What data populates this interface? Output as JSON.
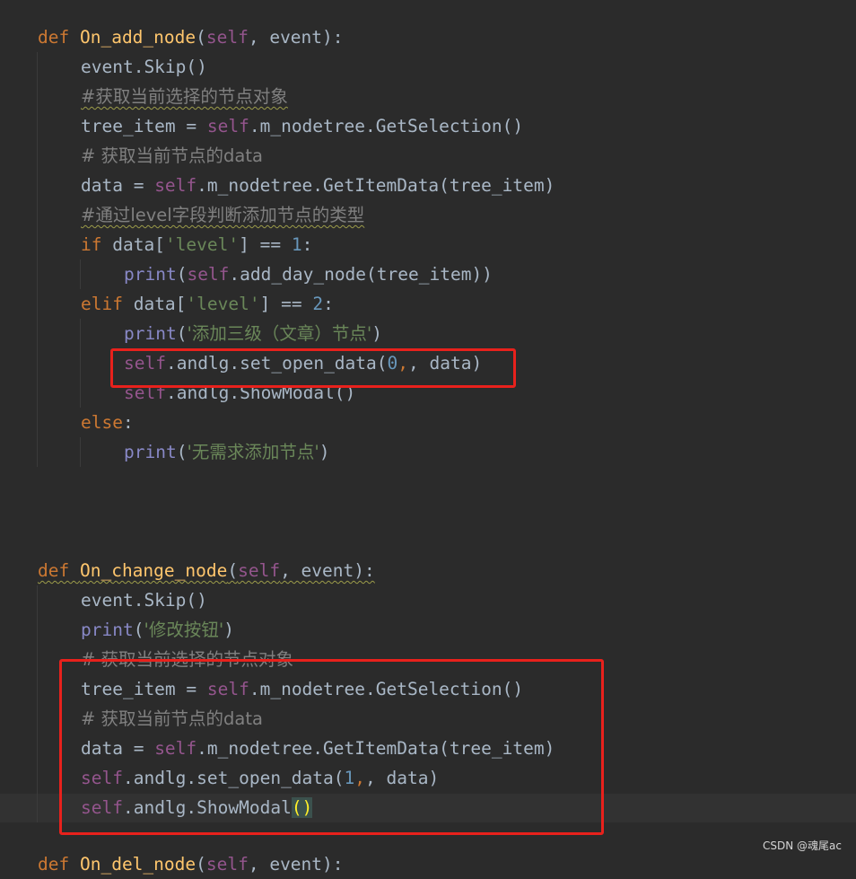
{
  "editor": {
    "current_line_note": "caret after ShowModal()",
    "func1": {
      "def_kw": "def",
      "name": "On_add_node",
      "open": "(",
      "self": "self",
      "params_rest": ", event):",
      "l1": "event.Skip()",
      "c1": "#获取当前选择的节点对象",
      "l2_a": "tree_item = ",
      "l2_self": "self",
      "l2_b": ".m_nodetree.GetSelection()",
      "c2": "# 获取当前节点的data",
      "l3_a": "data = ",
      "l3_self": "self",
      "l3_b": ".m_nodetree.GetItemData(tree_item)",
      "c3": "#通过level字段判断添加节点的类型",
      "if_kw": "if",
      "if_a": " data[",
      "if_str": "'level'",
      "if_b": "] == ",
      "if_num": "1",
      "if_c": ":",
      "p1_print": "print",
      "p1_a": "(",
      "p1_self": "self",
      "p1_b": ".add_day_node(tree_item))",
      "elif_kw": "elif",
      "elif_a": " data[",
      "elif_str": "'level'",
      "elif_b": "] == ",
      "elif_num": "2",
      "elif_c": ":",
      "p2_print": "print",
      "p2_a": "(",
      "p2_str": "'添加三级（文章）节点'",
      "p2_b": ")",
      "s1_self": "self",
      "s1_a": ".andlg.set_open_data(",
      "s1_num": "0",
      "s1_b": ", data)",
      "s2_self": "self",
      "s2_a": ".andlg.ShowModal()",
      "else_kw": "else",
      "else_c": ":",
      "p3_print": "print",
      "p3_a": "(",
      "p3_str": "'无需求添加节点'",
      "p3_b": ")"
    },
    "func2": {
      "def_kw": "def",
      "name": "On_change_node",
      "open": "(",
      "self": "self",
      "params_rest": ", event):",
      "l1": "event.Skip()",
      "p_print": "print",
      "p_a": "(",
      "p_str": "'修改按钮'",
      "p_b": ")",
      "c1": "# 获取当前选择的节点对象",
      "l2_a": "tree_item = ",
      "l2_self": "self",
      "l2_b": ".m_nodetree.GetSelection()",
      "c2": "# 获取当前节点的data",
      "l3_a": "data = ",
      "l3_self": "self",
      "l3_b": ".m_nodetree.GetItemData(tree_item)",
      "s1_self": "self",
      "s1_a": ".andlg.set_open_data(",
      "s1_num": "1",
      "s1_b": ", data)",
      "s2_self": "self",
      "s2_a": ".andlg.ShowModal",
      "s2_paren": "()"
    },
    "partial_next_line": "def On_del_node(self, event):"
  },
  "colors": {
    "background": "#2b2b2b",
    "keyword": "#cc7832",
    "function": "#ffc66d",
    "self": "#94558d",
    "string": "#6a8759",
    "number": "#6897bb",
    "comment": "#808080",
    "highlight_box": "#e8211c"
  },
  "watermark": "CSDN @魂尾ac"
}
